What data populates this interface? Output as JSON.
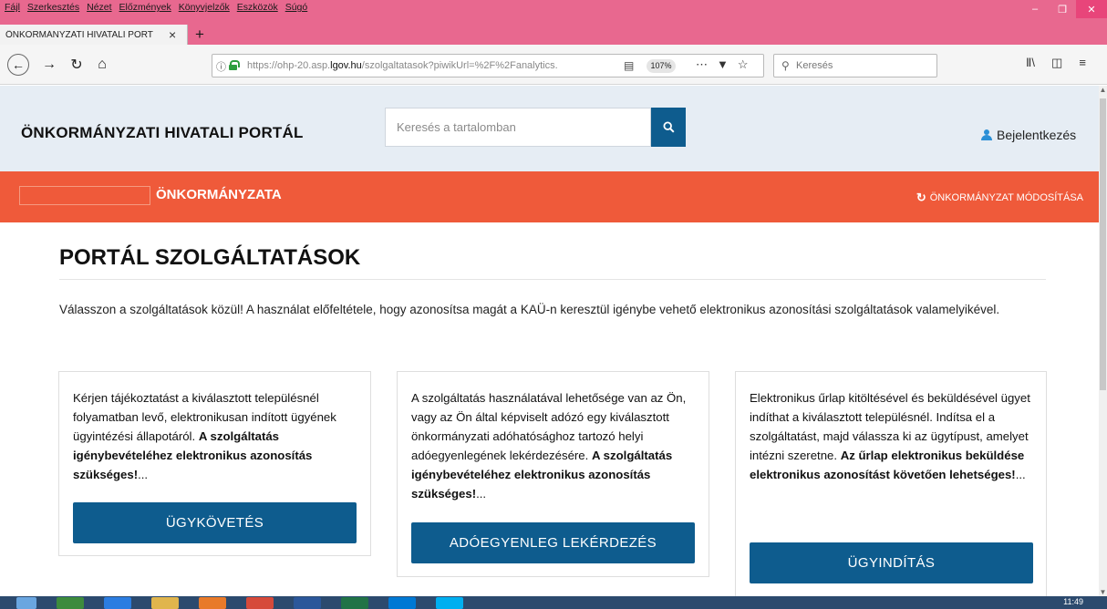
{
  "browser": {
    "menu": [
      "Fájl",
      "Szerkesztés",
      "Nézet",
      "Előzmények",
      "Könyvjelzők",
      "Eszközök",
      "Súgó"
    ],
    "tab_title": "ÖNKORMÁNYZATI HIVATALI PORT",
    "url_prefix": "https://ohp-20.asp.",
    "url_domain": "lgov.hu",
    "url_suffix": "/szolgaltatasok?piwikUrl=%2F%2Fanalytics.",
    "zoom": "107%",
    "search_placeholder": "Keresés"
  },
  "site": {
    "title": "ÖNKORMÁNYZATI HIVATALI PORTÁL",
    "search_placeholder": "Keresés a tartalomban",
    "login": "Bejelentkezés",
    "municipality_name": "ÖNKORMÁNYZATA",
    "municipality_change": "ÖNKORMÁNYZAT MÓDOSÍTÁSA",
    "heading": "PORTÁL SZOLGÁLTATÁSOK",
    "intro": "Válasszon a szolgáltatások közül! A használat előfeltétele, hogy azonosítsa magát a KAÜ-n keresztül igénybe vehető elektronikus azonosítási szolgáltatások valamelyikével."
  },
  "cards": [
    {
      "text": "Kérjen tájékoztatást a kiválasztott településnél folyamatban levő, elektronikusan indított ügyének ügyintézési állapotáról.",
      "bold": "A szolgáltatás igénybevételéhez elektronikus azonosítás szükséges!",
      "tail": "...",
      "button": "ÜGYKÖVETÉS"
    },
    {
      "text": "A szolgáltatás használatával lehetősége van az Ön, vagy az Ön által képviselt adózó egy kiválasztott önkormányzati adóhatósághoz tartozó helyi adóegyenlegének lekérdezésére.",
      "bold": "A szolgáltatás igénybevételéhez elektronikus azonosítás szükséges!",
      "tail": "...",
      "button": "ADÓEGYENLEG LEKÉRDEZÉS"
    },
    {
      "text": "Elektronikus űrlap kitöltésével és beküldésével ügyet indíthat a kiválasztott településnél. Indítsa el a szolgáltatást, majd válassza ki az ügytípust, amelyet intézni szeretne.",
      "bold": "Az űrlap elektronikus beküldése elektronikus azonosítást követően lehetséges!",
      "tail": "...",
      "button": "ÜGYINDÍTÁS"
    }
  ],
  "taskbar": {
    "time": "11:49"
  },
  "colors": {
    "orange": "#ef5a3a",
    "blue": "#0e5c8e",
    "header_bg": "#e6edf4",
    "chrome": "#e8688f"
  }
}
